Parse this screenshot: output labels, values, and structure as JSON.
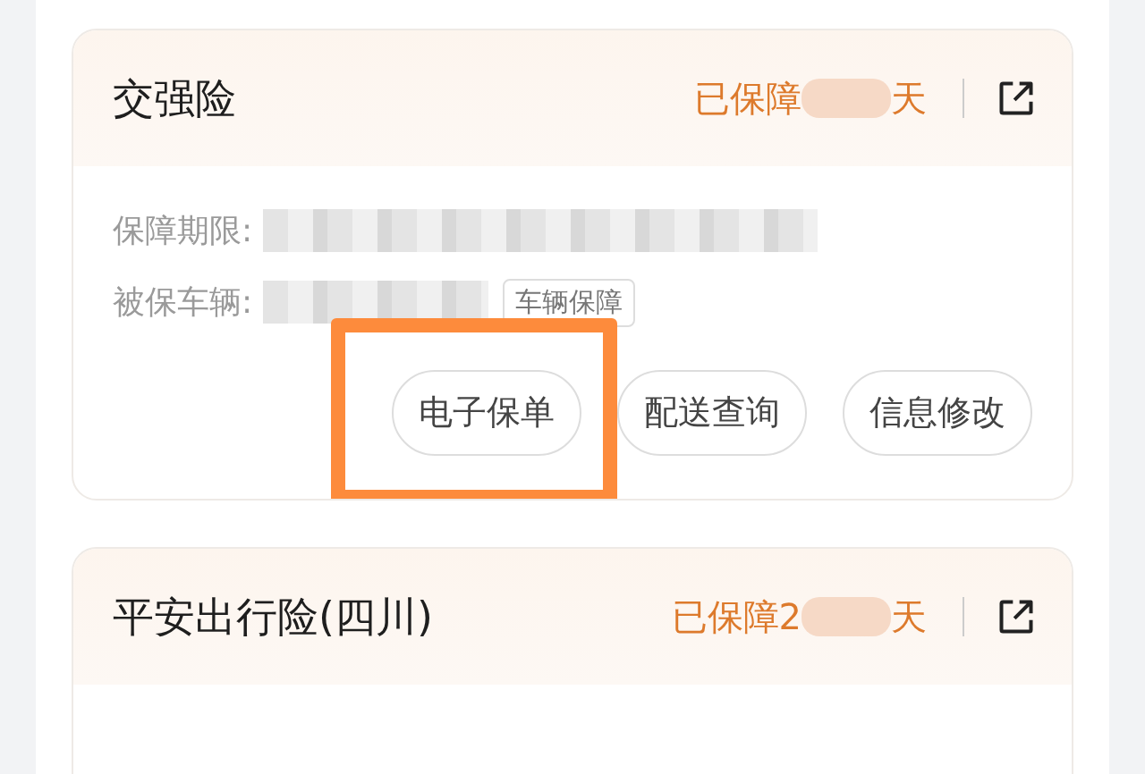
{
  "policies": [
    {
      "name": "交强险",
      "status_prefix": "已保障",
      "status_suffix": "天",
      "details": [
        {
          "label": "保障期限:"
        },
        {
          "label": "被保车辆:",
          "tag": "车辆保障"
        }
      ],
      "actions": [
        {
          "label": "电子保单",
          "highlighted": true
        },
        {
          "label": "配送查询",
          "highlighted": false
        },
        {
          "label": "信息修改",
          "highlighted": false
        }
      ]
    },
    {
      "name": "平安出行险(四川)",
      "status_prefix": "已保障2",
      "status_suffix": "天"
    }
  ]
}
